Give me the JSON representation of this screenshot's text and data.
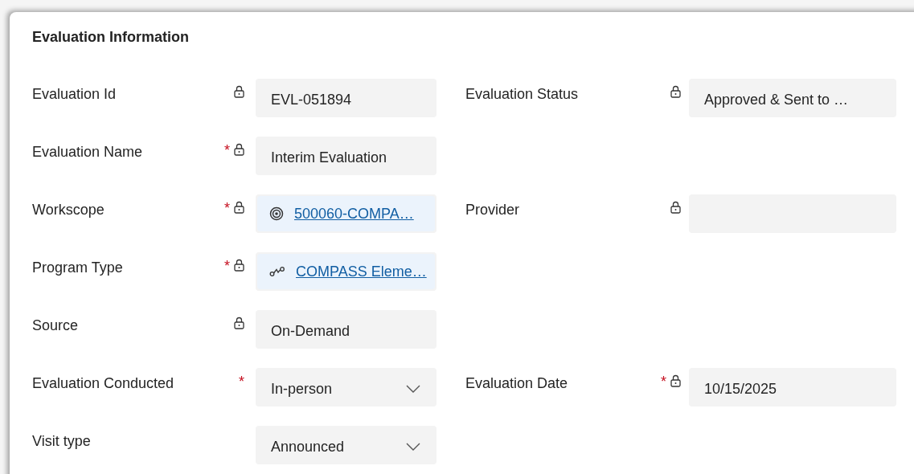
{
  "section": {
    "title": "Evaluation Information"
  },
  "rows": [
    {
      "left": {
        "label": "Evaluation Id",
        "locked": true,
        "kind": "text",
        "value": "EVL-051894"
      },
      "right": {
        "label": "Evaluation Status",
        "locked": true,
        "kind": "text",
        "value": "Approved & Sent to …"
      }
    },
    {
      "left": {
        "label": "Evaluation Name",
        "required_mark": "*",
        "locked": true,
        "kind": "text",
        "value": "Interim Evaluation"
      }
    },
    {
      "left": {
        "label": "Workscope",
        "required_mark": "*",
        "locked": true,
        "kind": "target",
        "value": "500060-COMPA…"
      },
      "right": {
        "label": "Provider",
        "locked": true,
        "kind": "text"
      }
    },
    {
      "left": {
        "label": "Program Type",
        "required_mark": "*",
        "locked": true,
        "kind": "connector",
        "value": "COMPASS Eleme…"
      }
    },
    {
      "left": {
        "label": "Source",
        "locked": true,
        "kind": "text",
        "value": "On-Demand"
      }
    },
    {
      "left": {
        "label": "Evaluation Conducted",
        "required_mark": "*",
        "locked": false,
        "kind": "select",
        "value": "In-person"
      },
      "right": {
        "label": "Evaluation Date",
        "required_mark": "*",
        "locked": true,
        "kind": "text",
        "value": "10/15/2025"
      }
    },
    {
      "left": {
        "label": "Visit type",
        "locked": false,
        "kind": "select",
        "value": "Announced"
      }
    }
  ]
}
